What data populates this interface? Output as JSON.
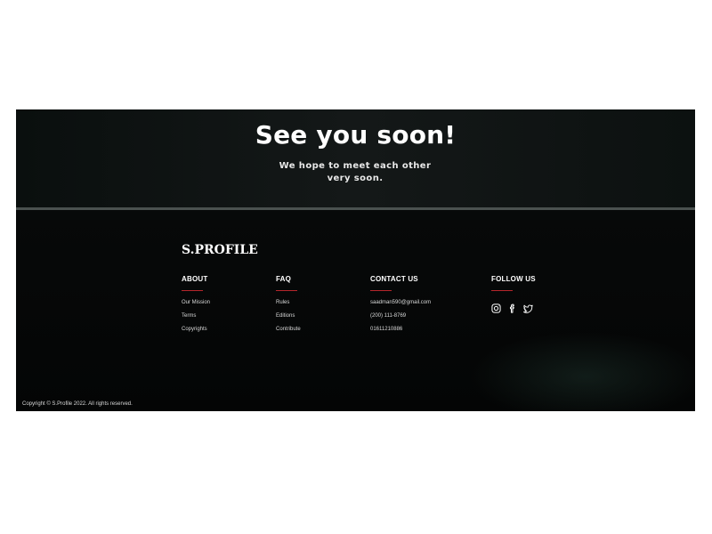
{
  "hero": {
    "title": "See you soon!",
    "subtitle": "We hope to meet each other very soon."
  },
  "footer": {
    "brand": "S.PROFILE",
    "accent_color": "#b5262b",
    "columns": [
      {
        "heading": "ABOUT",
        "links": [
          "Our Mission",
          "Terms",
          "Copyrights"
        ]
      },
      {
        "heading": "FAQ",
        "links": [
          "Rules",
          "Editions",
          "Contribute"
        ]
      },
      {
        "heading": "CONTACT US",
        "links": [
          "saadman590@gmail.com",
          "(200) 111-8769",
          "01611210886"
        ]
      },
      {
        "heading": "FOLLOW US",
        "icons": [
          "instagram-icon",
          "facebook-icon",
          "twitter-icon"
        ]
      }
    ],
    "copyright": "Copyright © S.Profile 2022. All rights reserved."
  }
}
